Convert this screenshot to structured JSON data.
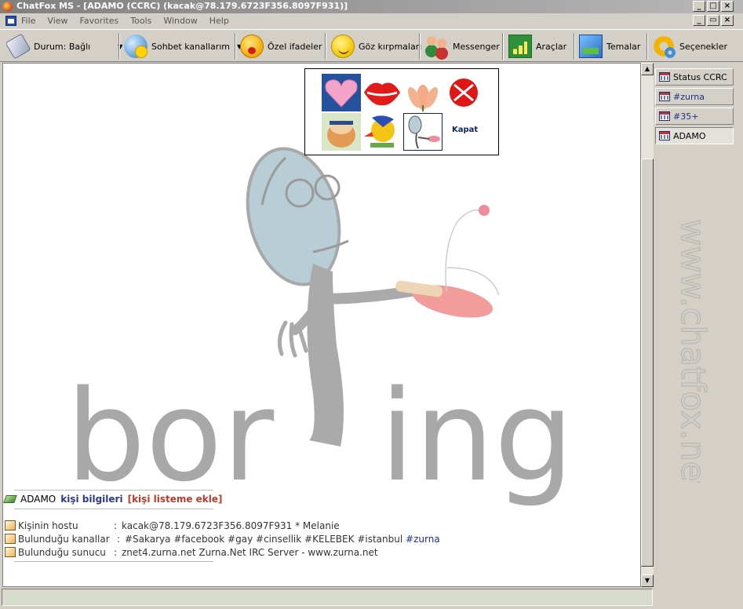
{
  "window": {
    "title": "ChatFox MS - [ADAMO (CCRC) (kacak@78.179.6723F356.8097F931)]",
    "controls": {
      "minimize": "_",
      "maximize": "□",
      "close": "×",
      "restore": "▭"
    }
  },
  "menu": {
    "items": [
      "File",
      "View",
      "Favorites",
      "Tools",
      "Window",
      "Help"
    ]
  },
  "toolbar": {
    "status_label": "Durum: Bağlı",
    "channels_label": "Sohbet kanallarım",
    "emoticons_label": "Özel ifadeler",
    "winks_label": "Göz kırpmaları",
    "messenger_label": "Messenger",
    "tools_label": "Araçlar",
    "themes_label": "Temalar",
    "options_label": "Seçenekler",
    "dropdown_caret": "▼"
  },
  "background_art": {
    "word_left": "bor",
    "word_right": "ing"
  },
  "emoticon_popup": {
    "icons": [
      "heart-emoticon",
      "lips-emoticon",
      "lotus-flower-emoticon",
      "red-ball-emoticon",
      "cartoon-dog-emoticon",
      "cartoon-bird-emoticon",
      "boring-man-emoticon"
    ],
    "close_label": "Kapat"
  },
  "user_info": {
    "nick": "ADAMO",
    "details_link": "kişi bilgileri",
    "add_link": "[kişi listeme ekle]",
    "rows": [
      {
        "label": "Kişinin hostu",
        "colon": ":",
        "value": "kacak@78.179.6723F356.8097F931 * Melanie"
      },
      {
        "label": "Bulunduğu kanallar",
        "colon": ":",
        "value": ""
      },
      {
        "label": "Bulunduğu sunucu",
        "colon": ":",
        "value": "znet4.zurna.net Zurna.Net IRC Server - www.zurna.net"
      }
    ],
    "channels": [
      "#Sakarya",
      "#facebook",
      "#gay",
      "#cinsellik",
      "#KELEBEK",
      "#istanbul",
      "#zurna"
    ],
    "highlighted_channel": "#zurna"
  },
  "scrollbar": {
    "up": "▲",
    "down": "▼"
  },
  "right_panel": {
    "tabs": [
      {
        "label": "Status CCRC",
        "is_link": false
      },
      {
        "label": "#zurna",
        "is_link": true
      },
      {
        "label": "#35+",
        "is_link": true
      },
      {
        "label": "ADAMO",
        "is_link": false
      }
    ],
    "watermark": "www.chatfox.net"
  },
  "colors": {
    "titlebar_start": "#808080",
    "titlebar_end": "#b8b8b8",
    "chrome": "#d4d0c8",
    "link_blue": "#2b3a8c",
    "add_red": "#c0392b"
  }
}
